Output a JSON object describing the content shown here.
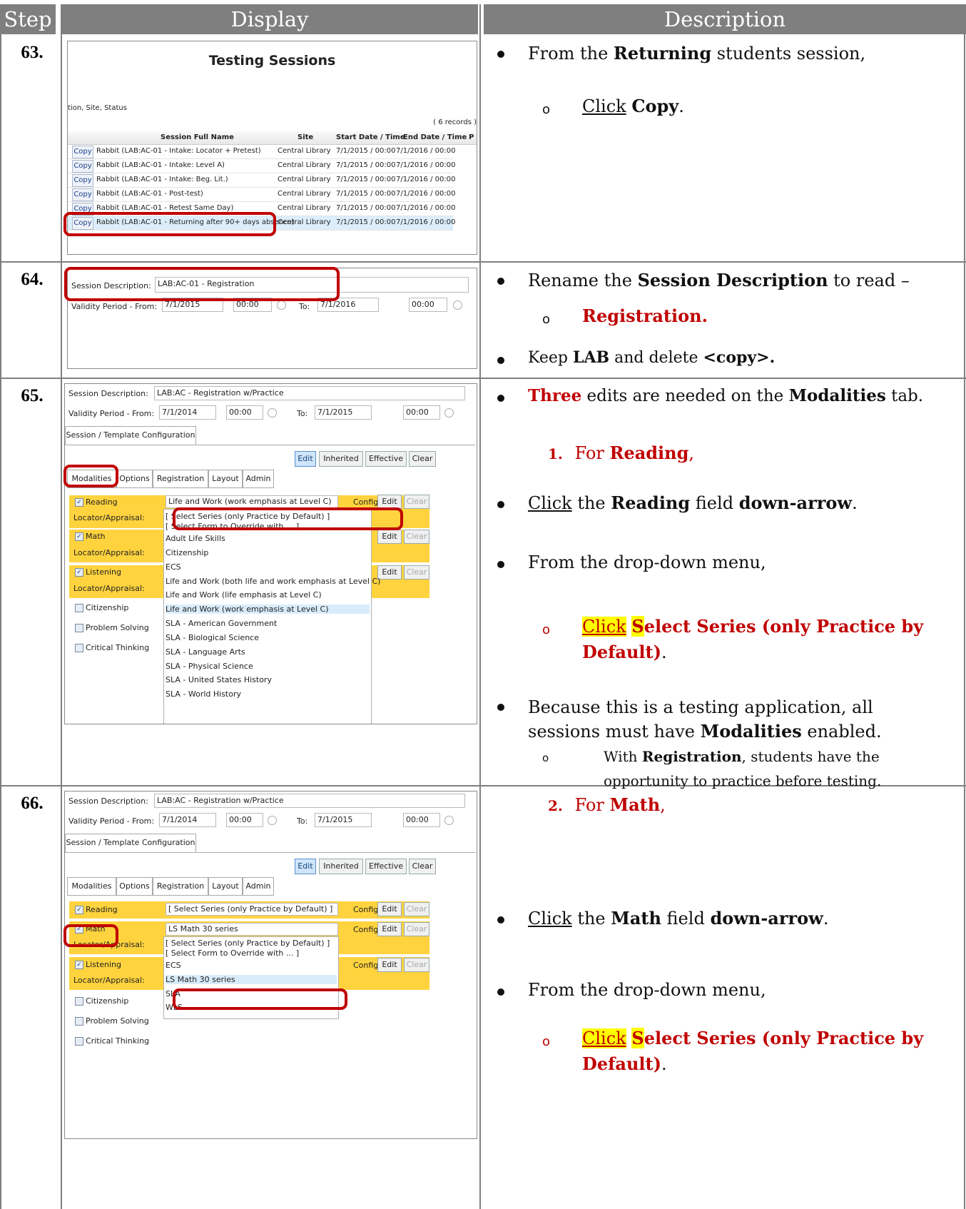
{
  "header": {
    "col_step": "Step",
    "col_display": "Display",
    "col_description": "Description"
  },
  "steps": [
    {
      "number": "63.",
      "screen": {
        "title": "Testing Sessions",
        "filter_text": "tion, Site, Status",
        "records": "( 6 records )",
        "columns": [
          "Session Full Name",
          "Site",
          "Start Date / Time",
          "End Date / Time",
          "P"
        ],
        "copy_label": "Copy",
        "rows": [
          {
            "name": "Rabbit (LAB:AC-01 - Intake: Locator + Pretest)",
            "site": "Central Library",
            "start": "7/1/2015 / 00:00",
            "end": "7/1/2016 / 00:00"
          },
          {
            "name": "Rabbit (LAB:AC-01 - Intake: Level A)",
            "site": "Central Library",
            "start": "7/1/2015 / 00:00",
            "end": "7/1/2016 / 00:00"
          },
          {
            "name": "Rabbit (LAB:AC-01 - Intake: Beg. Lit.)",
            "site": "Central Library",
            "start": "7/1/2015 / 00:00",
            "end": "7/1/2016 / 00:00"
          },
          {
            "name": "Rabbit (LAB:AC-01 - Post-test)",
            "site": "Central Library",
            "start": "7/1/2015 / 00:00",
            "end": "7/1/2016 / 00:00"
          },
          {
            "name": "Rabbit (LAB:AC-01 - Retest Same Day)",
            "site": "Central Library",
            "start": "7/1/2015 / 00:00",
            "end": "7/1/2016 / 00:00"
          },
          {
            "name": "Rabbit (LAB:AC-01 - Returning after 90+ days absence)",
            "site": "Central Library",
            "start": "7/1/2015 / 00:00",
            "end": "7/1/2016 / 00:00"
          }
        ]
      },
      "desc": {
        "line1_pre": "From the ",
        "line1_bold": "Returning",
        "line1_post": " students session,",
        "sub_click": "Click",
        "sub_bold": "Copy",
        "sub_post": "."
      }
    },
    {
      "number": "64.",
      "screen": {
        "label": "Session Description:",
        "value": "LAB:AC-01 - Registration",
        "validity": "Validity Period - From:",
        "from_date": "7/1/2015",
        "from_time": "00:00",
        "to_label": "To:",
        "to_date": "7/1/2016",
        "to_time": "00:00"
      },
      "desc": {
        "line1_pre": "Rename the ",
        "line1_bold": "Session Description",
        "line1_post": " to read –",
        "sub_red": "Registration.",
        "line2_pre": "Keep ",
        "line2_bold1": "LAB",
        "line2_mid": " and delete ",
        "line2_bold2": "<copy>."
      }
    },
    {
      "number": "65.",
      "screen": {
        "label": "Session Description:",
        "value": "LAB:AC - Registration w/Practice",
        "validity": "Validity Period - From:",
        "from_date": "7/1/2014",
        "from_time": "00:00",
        "to_label": "To:",
        "to_date": "7/1/2015",
        "to_time": "00:00",
        "config_tab": "Session / Template Configuration",
        "buttons": [
          "Edit",
          "Inherited",
          "Effective",
          "Clear"
        ],
        "tabs": [
          "Modalities",
          "Options",
          "Registration",
          "Layout",
          "Admin"
        ],
        "reading": "Reading",
        "reading_value": "Life and Work (work emphasis at Level C)",
        "config": "Config.:",
        "edit": "Edit",
        "clear": "Clear",
        "locator": "Locator/Appraisal:",
        "math": "Math",
        "listening": "Listening",
        "others": [
          "Citizenship",
          "Problem Solving",
          "Critical Thinking"
        ],
        "dropdown": [
          "[ Select Series (only Practice by Default) ]",
          "[ Select Form to Override with ... ]",
          "Adult Life Skills",
          "Citizenship",
          "ECS",
          "Life and Work (both life and work emphasis at Level C)",
          "Life and Work (life emphasis at Level C)",
          "Life and Work (work emphasis at Level C)",
          "SLA - American Government",
          "SLA - Biological Science",
          "SLA - Language Arts",
          "SLA - Physical Science",
          "SLA - United States History",
          "SLA - World History"
        ]
      },
      "desc": {
        "l1_red": "Three",
        "l1_mid": " edits are needed on the ",
        "l1_bold": "Modalities",
        "l1_post": " tab.",
        "num1": "1.",
        "num1_pre": "For ",
        "num1_bold": "Reading",
        "num1_post": ",",
        "l2_click": "Click",
        "l2_mid": " the ",
        "l2_bold1": "Reading",
        "l2_mid2": " field ",
        "l2_bold2": "down-arrow",
        "l2_post": ".",
        "l3": "From the drop-down menu,",
        "sub_click": "Click",
        "sub_s": "S",
        "sub_red1": "elect Series (only Practice by",
        "sub_red2": "Default)",
        "sub_post": ".",
        "l4a": "Because this is a testing application, all",
        "l4b_pre": "sessions must have ",
        "l4b_bold": "Modalities",
        "l4b_post": " enabled.",
        "sub2_pre": "With ",
        "sub2_bold": "Registration",
        "sub2_post": ", students have the",
        "sub2_l2": "opportunity to practice before testing."
      }
    },
    {
      "number": "66.",
      "screen": {
        "label": "Session Description:",
        "value": "LAB:AC - Registration w/Practice",
        "validity": "Validity Period - From:",
        "from_date": "7/1/2014",
        "from_time": "00:00",
        "to_label": "To:",
        "to_date": "7/1/2015",
        "to_time": "00:00",
        "config_tab": "Session / Template Configuration",
        "buttons": [
          "Edit",
          "Inherited",
          "Effective",
          "Clear"
        ],
        "tabs": [
          "Modalities",
          "Options",
          "Registration",
          "Layout",
          "Admin"
        ],
        "reading": "Reading",
        "reading_value": "[ Select Series (only Practice by Default) ]",
        "math": "Math",
        "math_value": "LS Math 30 series",
        "config": "Config.:",
        "edit": "Edit",
        "clear": "Clear",
        "locator": "Locator/Appraisal:",
        "listening": "Listening",
        "others": [
          "Citizenship",
          "Problem Solving",
          "Critical Thinking"
        ],
        "dropdown": [
          "[ Select Series (only Practice by Default) ]",
          "[ Select Form to Override with ... ]",
          "ECS",
          "LS Math 30 series",
          "SLA",
          "WLS"
        ]
      },
      "desc": {
        "num2": "2.",
        "num2_pre": "For ",
        "num2_bold": "Math",
        "num2_post": ",",
        "l2_click": "Click",
        "l2_mid": " the ",
        "l2_bold1": "Math",
        "l2_mid2": " field ",
        "l2_bold2": "down-arrow",
        "l2_post": ".",
        "l3": "From the drop-down menu,",
        "sub_click": "Click",
        "sub_s": "S",
        "sub_red1": "elect Series (only Practice by",
        "sub_red2": "Default)",
        "sub_post": "."
      }
    }
  ]
}
